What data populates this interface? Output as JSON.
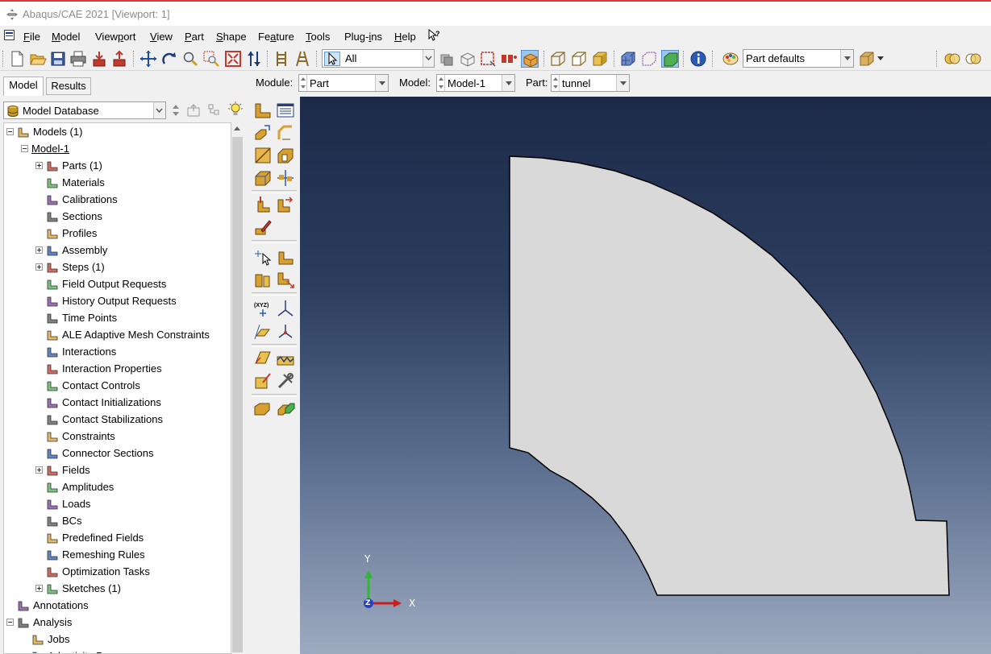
{
  "window": {
    "title": "Abaqus/CAE 2021 [Viewport: 1]"
  },
  "menu": [
    {
      "accel": "F",
      "rest": "ile"
    },
    {
      "accel": "M",
      "rest": "odel"
    },
    {
      "pre": "View",
      "accel": "p",
      "rest": "ort"
    },
    {
      "accel": "V",
      "rest": "iew"
    },
    {
      "accel": "P",
      "rest": "art"
    },
    {
      "accel": "S",
      "rest": "hape"
    },
    {
      "pre": "Fe",
      "accel": "a",
      "rest": "ture"
    },
    {
      "accel": "T",
      "rest": "ools"
    },
    {
      "pre": "Plug-",
      "accel": "i",
      "rest": "ns"
    },
    {
      "accel": "H",
      "rest": "elp"
    },
    {
      "pre": "",
      "accel": "",
      "rest": "⁇"
    }
  ],
  "toolbar": {
    "selection_filter": "All",
    "render_style": "Part defaults"
  },
  "context_bar": {
    "module_label": "Module:",
    "module_value": "Part",
    "model_label": "Model:",
    "model_value": "Model-1",
    "part_label": "Part:",
    "part_value": "tunnel"
  },
  "tabs": {
    "model": "Model",
    "results": "Results"
  },
  "tree_header": {
    "database": "Model Database"
  },
  "tree": [
    {
      "label": "Models (1)",
      "level": 0,
      "expander": "minus",
      "icon": "models-icon"
    },
    {
      "label": "Model-1",
      "level": 1,
      "expander": "minus",
      "icon": "",
      "underline": true
    },
    {
      "label": "Parts (1)",
      "level": 2,
      "expander": "plus",
      "icon": "parts-icon"
    },
    {
      "label": "Materials",
      "level": 2,
      "expander": "",
      "icon": "materials-icon"
    },
    {
      "label": "Calibrations",
      "level": 2,
      "expander": "",
      "icon": "calibrations-icon"
    },
    {
      "label": "Sections",
      "level": 2,
      "expander": "",
      "icon": "sections-icon"
    },
    {
      "label": "Profiles",
      "level": 2,
      "expander": "",
      "icon": "profiles-icon"
    },
    {
      "label": "Assembly",
      "level": 2,
      "expander": "plus",
      "icon": "assembly-icon"
    },
    {
      "label": "Steps (1)",
      "level": 2,
      "expander": "plus",
      "icon": "steps-icon"
    },
    {
      "label": "Field Output Requests",
      "level": 2,
      "expander": "",
      "icon": "field-output-icon"
    },
    {
      "label": "History Output Requests",
      "level": 2,
      "expander": "",
      "icon": "history-output-icon"
    },
    {
      "label": "Time Points",
      "level": 2,
      "expander": "",
      "icon": "time-points-icon"
    },
    {
      "label": "ALE Adaptive Mesh Constraints",
      "level": 2,
      "expander": "",
      "icon": "ale-icon"
    },
    {
      "label": "Interactions",
      "level": 2,
      "expander": "",
      "icon": "interactions-icon"
    },
    {
      "label": "Interaction Properties",
      "level": 2,
      "expander": "",
      "icon": "interaction-properties-icon"
    },
    {
      "label": "Contact Controls",
      "level": 2,
      "expander": "",
      "icon": "contact-controls-icon"
    },
    {
      "label": "Contact Initializations",
      "level": 2,
      "expander": "",
      "icon": "contact-init-icon"
    },
    {
      "label": "Contact Stabilizations",
      "level": 2,
      "expander": "",
      "icon": "contact-stab-icon"
    },
    {
      "label": "Constraints",
      "level": 2,
      "expander": "",
      "icon": "constraints-icon"
    },
    {
      "label": "Connector Sections",
      "level": 2,
      "expander": "",
      "icon": "connector-icon"
    },
    {
      "label": "Fields",
      "level": 2,
      "expander": "plus",
      "icon": "fields-icon"
    },
    {
      "label": "Amplitudes",
      "level": 2,
      "expander": "",
      "icon": "amplitudes-icon"
    },
    {
      "label": "Loads",
      "level": 2,
      "expander": "",
      "icon": "loads-icon"
    },
    {
      "label": "BCs",
      "level": 2,
      "expander": "",
      "icon": "bcs-icon"
    },
    {
      "label": "Predefined Fields",
      "level": 2,
      "expander": "",
      "icon": "predefined-icon"
    },
    {
      "label": "Remeshing Rules",
      "level": 2,
      "expander": "",
      "icon": "remeshing-icon"
    },
    {
      "label": "Optimization Tasks",
      "level": 2,
      "expander": "",
      "icon": "optimization-icon"
    },
    {
      "label": "Sketches (1)",
      "level": 2,
      "expander": "plus",
      "icon": "sketches-icon"
    },
    {
      "label": "Annotations",
      "level": 0,
      "expander": "",
      "icon": "annotations-icon"
    },
    {
      "label": "Analysis",
      "level": 0,
      "expander": "minus",
      "icon": "analysis-icon"
    },
    {
      "label": "Jobs",
      "level": 1,
      "expander": "",
      "icon": "jobs-icon"
    },
    {
      "label": "Adaptivity Processes",
      "level": 1,
      "expander": "",
      "icon": "adaptivity-icon"
    }
  ],
  "viewport": {
    "triad": {
      "x_label": "X",
      "y_label": "Y",
      "z_label": "Z"
    },
    "colors": {
      "part_fill": "#d9d9d9",
      "part_edge": "#000000",
      "bg_top": "#1c2a48",
      "bg_bottom": "#9daac0"
    }
  }
}
